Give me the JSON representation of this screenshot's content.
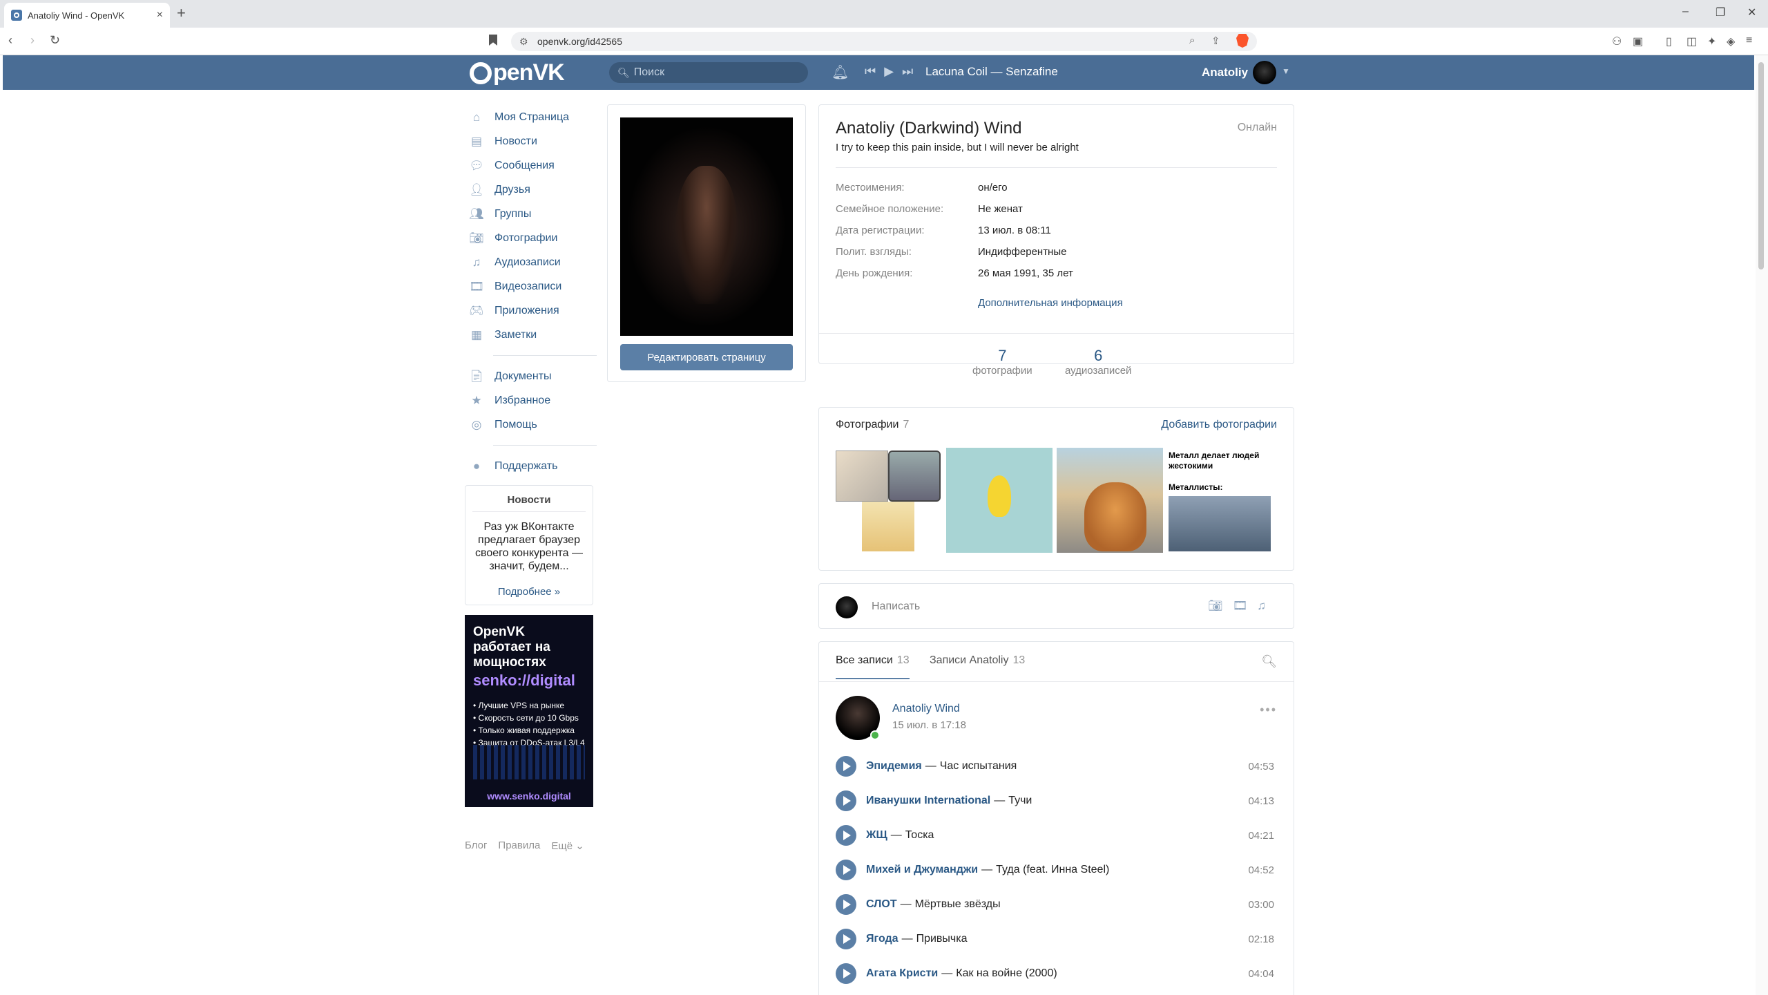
{
  "browser": {
    "tab_title": "Anatoliy Wind - OpenVK",
    "tab_close": "×",
    "new_tab": "+",
    "url": "openvk.org/id42565",
    "win_min": "–",
    "win_max": "❐",
    "win_close": "✕"
  },
  "header": {
    "logo_text": "penVK",
    "search_placeholder": "Поиск",
    "now_playing": "Lacuna Coil — Senzafine",
    "user_name": "Anatoliy",
    "accent": "#4a6d95"
  },
  "sidebar": {
    "items": [
      {
        "label": "Моя Страница",
        "icon": "home-icon"
      },
      {
        "label": "Новости",
        "icon": "news-icon"
      },
      {
        "label": "Сообщения",
        "icon": "messages-icon"
      },
      {
        "label": "Друзья",
        "icon": "friends-icon"
      },
      {
        "label": "Группы",
        "icon": "groups-icon"
      },
      {
        "label": "Фотографии",
        "icon": "camera-icon"
      },
      {
        "label": "Аудиозаписи",
        "icon": "music-icon"
      },
      {
        "label": "Видеозаписи",
        "icon": "video-icon"
      },
      {
        "label": "Приложения",
        "icon": "gamepad-icon"
      },
      {
        "label": "Заметки",
        "icon": "notes-icon"
      }
    ],
    "items2": [
      {
        "label": "Документы",
        "icon": "document-icon"
      },
      {
        "label": "Избранное",
        "icon": "star-icon"
      },
      {
        "label": "Помощь",
        "icon": "help-icon"
      }
    ],
    "donate": {
      "label": "Поддержать",
      "icon": "donate-icon"
    },
    "news_card": {
      "heading": "Новости",
      "text": "Раз уж ВКонтакте предлагает браузер своего конкурента — значит, будем...",
      "more": "Подробнее »"
    },
    "ad": {
      "line1": "OpenVK работает на мощностях",
      "line2": "senko://digital",
      "bullets": [
        "• Лучшие VPS на рынке",
        "• Скорость сети до 10 Gbps",
        "• Только живая поддержка",
        "• Защита от DDoS-атак L3/L4"
      ],
      "site": "www.senko.digital"
    },
    "footer": {
      "blog": "Блог",
      "rules": "Правила",
      "more": "Ещё ⌄"
    }
  },
  "profile": {
    "edit_button": "Редактировать страницу",
    "name": "Anatoliy (Darkwind) Wind",
    "online": "Онлайн",
    "status": "I try to keep this pain inside, but I will never be alright",
    "info": [
      {
        "key": "Местоимения:",
        "value": "он/его"
      },
      {
        "key": "Семейное положение:",
        "value": "Не женат"
      },
      {
        "key": "Дата регистрации:",
        "value": "13 июл. в 08:11"
      },
      {
        "key": "Полит. взгляды:",
        "value": "Индифферентные"
      },
      {
        "key": "День рождения:",
        "value": "26 мая 1991, 35 лет"
      }
    ],
    "more_info": "Дополнительная информация",
    "counters": [
      {
        "n": "7",
        "label": "фотографии"
      },
      {
        "n": "6",
        "label": "аудиозаписей"
      }
    ]
  },
  "photos": {
    "title": "Фотографии",
    "count": "7",
    "add": "Добавить фотографии",
    "meme_caption1": "Металл делает людей жестокими",
    "meme_caption2": "Металлисты:"
  },
  "composer": {
    "placeholder": "Написать"
  },
  "wall": {
    "tab_all": "Все записи",
    "tab_all_count": "13",
    "tab_own": "Записи Anatoliy",
    "tab_own_count": "13",
    "post": {
      "author": "Anatoliy Wind",
      "date": "15 июл. в 17:18",
      "menu": "•••",
      "tracks": [
        {
          "artist": "Эпидемия",
          "title": "Час испытания",
          "dur": "04:53"
        },
        {
          "artist": "Иванушки International",
          "title": "Тучи",
          "dur": "04:13"
        },
        {
          "artist": "ЖЩ",
          "title": "Тоска",
          "dur": "04:21"
        },
        {
          "artist": "Михей и Джуманджи",
          "title": "Туда (feat. Инна Steel)",
          "dur": "04:52"
        },
        {
          "artist": "СЛОТ",
          "title": "Мёртвые звёзды",
          "dur": "03:00"
        },
        {
          "artist": "Ягода",
          "title": "Привычка",
          "dur": "02:18"
        },
        {
          "artist": "Агата Кристи",
          "title": "Как на войне (2000)",
          "dur": "04:04"
        }
      ]
    }
  }
}
